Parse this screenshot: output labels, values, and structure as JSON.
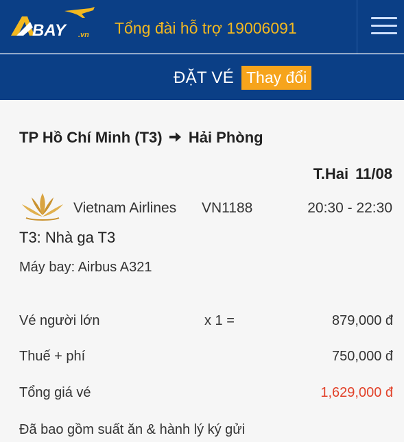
{
  "header": {
    "logo_text": "BAY",
    "logo_suffix": ".vn",
    "hotline_label": "Tổng đài hỗ trợ 19006091",
    "menu_icon": "hamburger-menu-icon"
  },
  "subheader": {
    "title": "ĐẶT VÉ",
    "change_label": "Thay đổi"
  },
  "flight": {
    "origin": "TP Hồ Chí Minh (T3)",
    "arrow_icon": "arrow-right-icon",
    "destination": "Hải Phòng",
    "weekday": "T.Hai",
    "date": "11/08",
    "airline_logo_icon": "lotus-icon",
    "airline": "Vietnam Airlines",
    "flight_number": "VN1188",
    "time": "20:30 - 22:30",
    "terminal": "T3: Nhà ga T3",
    "aircraft": "Máy bay: Airbus A321"
  },
  "pricing": {
    "adult_label": "Vé người lớn",
    "adult_multiplier": "x 1 =",
    "adult_price": "879,000 đ",
    "tax_label": "Thuế + phí",
    "tax_price": "750,000 đ",
    "total_label": "Tổng giá vé",
    "total_price": "1,629,000 đ",
    "note": "Đã bao gồm suất ăn & hành lý ký gửi"
  },
  "colors": {
    "header_bg": "#0b3f86",
    "accent_orange": "#f6a41c",
    "hotline_text": "#f3b81f",
    "total_price": "#e2422a"
  }
}
